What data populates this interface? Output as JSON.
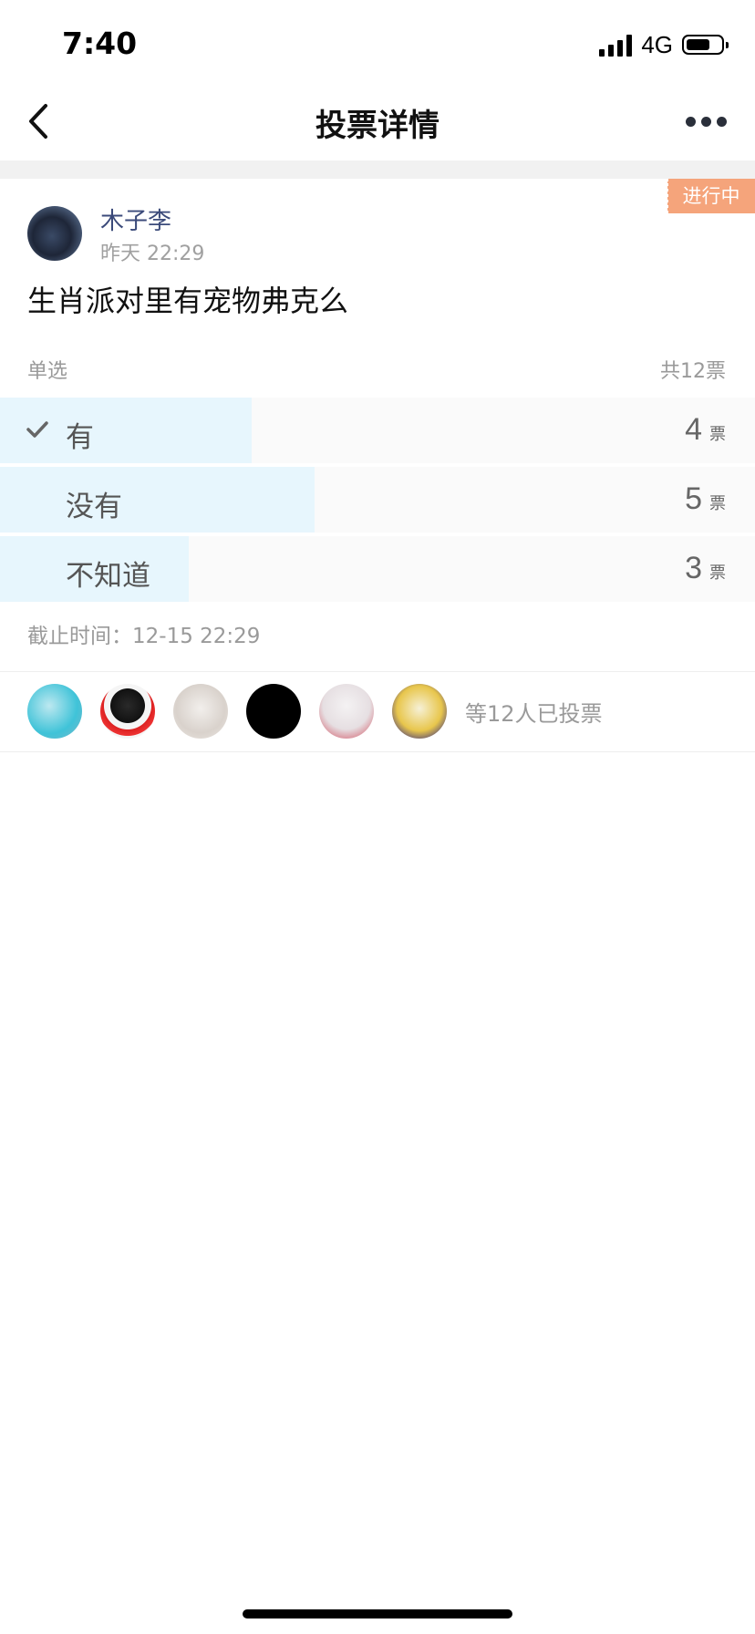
{
  "status_bar": {
    "time": "7:40",
    "network": "4G",
    "battery_level": 0.7
  },
  "nav": {
    "title": "投票详情",
    "back_icon": "chevron-left-icon",
    "more_icon": "more-dots-icon"
  },
  "post": {
    "status_badge": "进行中",
    "author": "木子李",
    "time": "昨天 22:29",
    "question": "生肖派对里有宠物弗克么"
  },
  "poll": {
    "type": "单选",
    "total": "共12票",
    "options": [
      {
        "label": "有",
        "count": "4",
        "unit": "票",
        "selected": true,
        "share": 0.333
      },
      {
        "label": "没有",
        "count": "5",
        "unit": "票",
        "selected": false,
        "share": 0.417
      },
      {
        "label": "不知道",
        "count": "3",
        "unit": "票",
        "selected": false,
        "share": 0.25
      }
    ],
    "deadline_label": "截止时间：",
    "deadline_value": "12-15 22:29"
  },
  "voters": {
    "summary": "等12人已投票"
  },
  "colors": {
    "badge": "#f5a47b",
    "option_fill": "#e7f6fd",
    "author": "#3b4a7a"
  }
}
